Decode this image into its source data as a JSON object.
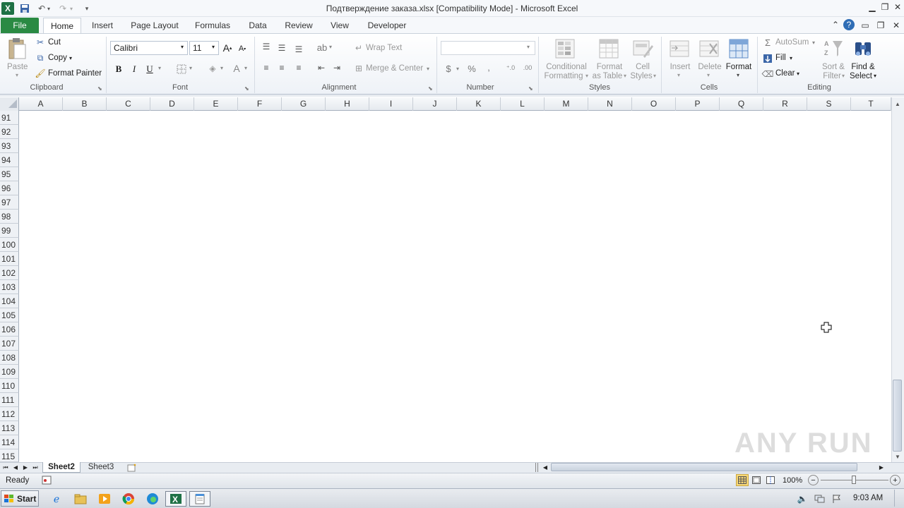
{
  "window": {
    "title": "Подтверждение заказа.xlsx  [Compatibility Mode] - Microsoft Excel",
    "app_icon": "X"
  },
  "tabs": [
    "File",
    "Home",
    "Insert",
    "Page Layout",
    "Formulas",
    "Data",
    "Review",
    "View",
    "Developer"
  ],
  "ribbon": {
    "clipboard": {
      "paste": "Paste",
      "cut": "Cut",
      "copy": "Copy",
      "format_painter": "Format Painter",
      "label": "Clipboard"
    },
    "font": {
      "name": "Calibri",
      "size": "11",
      "bold": "B",
      "italic": "I",
      "underline": "U",
      "label": "Font"
    },
    "alignment": {
      "wrap_text": "Wrap Text",
      "merge_center": "Merge & Center",
      "label": "Alignment"
    },
    "number": {
      "format": "",
      "currency": "$",
      "percent": "%",
      "comma": ",",
      "label": "Number"
    },
    "styles": {
      "conditional_1": "Conditional",
      "conditional_2": "Formatting",
      "format_table_1": "Format",
      "format_table_2": "as Table",
      "cell_styles_1": "Cell",
      "cell_styles_2": "Styles",
      "label": "Styles"
    },
    "cells": {
      "insert": "Insert",
      "delete": "Delete",
      "format": "Format",
      "label": "Cells"
    },
    "editing": {
      "autosum": "AutoSum",
      "fill": "Fill",
      "clear": "Clear",
      "sort_1": "Sort &",
      "sort_2": "Filter",
      "find_1": "Find &",
      "find_2": "Select",
      "label": "Editing"
    }
  },
  "columns": [
    "A",
    "B",
    "C",
    "D",
    "E",
    "F",
    "G",
    "H",
    "I",
    "J",
    "K",
    "L",
    "M",
    "N",
    "O",
    "P",
    "Q",
    "R",
    "S",
    "T"
  ],
  "rows": [
    "91",
    "92",
    "93",
    "94",
    "95",
    "96",
    "97",
    "98",
    "99",
    "100",
    "101",
    "102",
    "103",
    "104",
    "105",
    "106",
    "107",
    "108",
    "109",
    "110",
    "111",
    "112",
    "113",
    "114",
    "115"
  ],
  "sheets": [
    "Sheet2",
    "Sheet3"
  ],
  "status": {
    "ready": "Ready",
    "zoom": "100%"
  },
  "taskbar": {
    "start": "Start",
    "clock": "9:03 AM"
  },
  "watermark": "ANY RUN"
}
